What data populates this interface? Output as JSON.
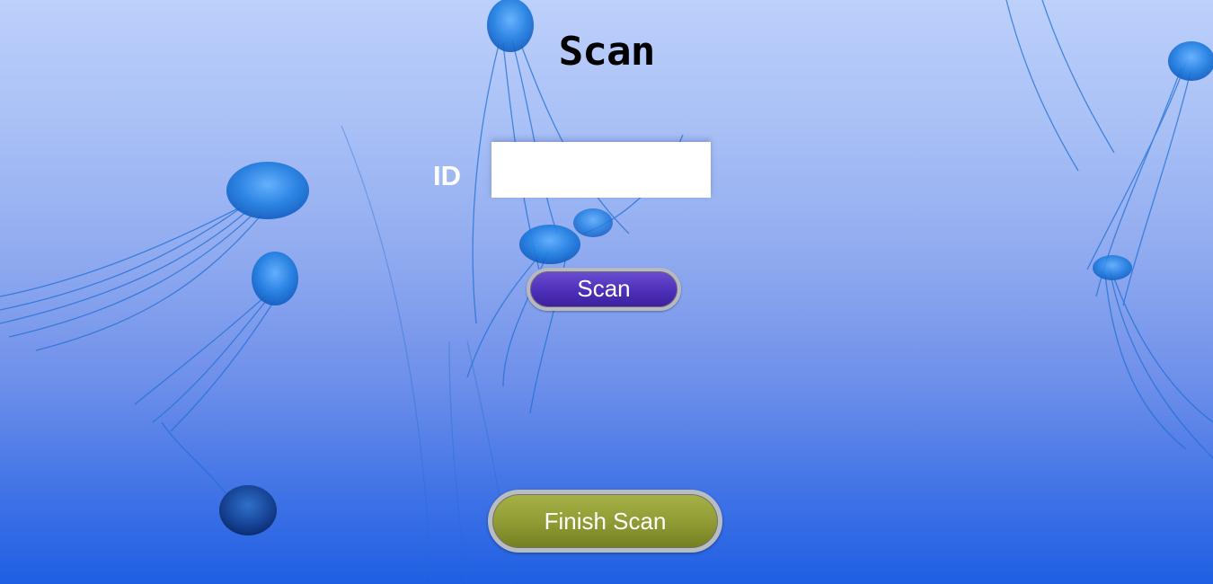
{
  "page": {
    "title": "Scan"
  },
  "form": {
    "id_label": "ID",
    "id_value": "",
    "scan_label": "Scan",
    "finish_label": "Finish Scan"
  },
  "background": {
    "theme": "jellyfish",
    "colors": {
      "top": "#bcd0fb",
      "bottom": "#1f5fe3",
      "jellyfish": "#1e6fd6"
    }
  },
  "colors": {
    "scan_button": "#4e2fb8",
    "finish_button": "#8f9a33",
    "title": "#000000",
    "label": "#ffffff"
  }
}
